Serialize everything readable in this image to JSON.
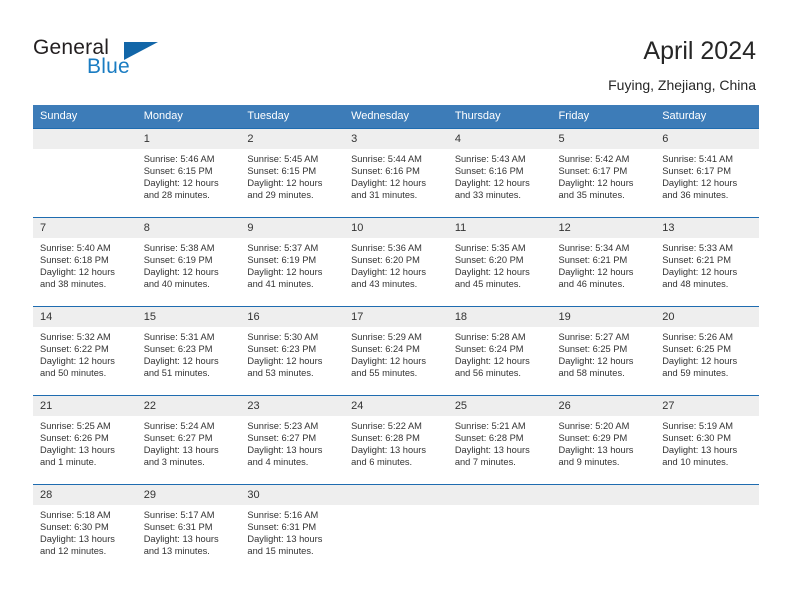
{
  "brand": {
    "name_part1": "General",
    "name_part2": "Blue",
    "accent_color": "#1266a8",
    "logo_icon": "triangle-flag-icon"
  },
  "header": {
    "title": "April 2024",
    "location": "Fuying, Zhejiang, China"
  },
  "calendar": {
    "theme": {
      "header_bg": "#3d7cb8",
      "header_text": "#ffffff",
      "row_divider": "#1f6cb0",
      "daynum_bg": "#eeeeee"
    },
    "weekday_headers": [
      "Sunday",
      "Monday",
      "Tuesday",
      "Wednesday",
      "Thursday",
      "Friday",
      "Saturday"
    ],
    "weeks": [
      [
        {
          "day": "",
          "sunrise": "",
          "sunset": "",
          "daylight_1": "",
          "daylight_2": ""
        },
        {
          "day": "1",
          "sunrise": "Sunrise: 5:46 AM",
          "sunset": "Sunset: 6:15 PM",
          "daylight_1": "Daylight: 12 hours",
          "daylight_2": "and 28 minutes."
        },
        {
          "day": "2",
          "sunrise": "Sunrise: 5:45 AM",
          "sunset": "Sunset: 6:15 PM",
          "daylight_1": "Daylight: 12 hours",
          "daylight_2": "and 29 minutes."
        },
        {
          "day": "3",
          "sunrise": "Sunrise: 5:44 AM",
          "sunset": "Sunset: 6:16 PM",
          "daylight_1": "Daylight: 12 hours",
          "daylight_2": "and 31 minutes."
        },
        {
          "day": "4",
          "sunrise": "Sunrise: 5:43 AM",
          "sunset": "Sunset: 6:16 PM",
          "daylight_1": "Daylight: 12 hours",
          "daylight_2": "and 33 minutes."
        },
        {
          "day": "5",
          "sunrise": "Sunrise: 5:42 AM",
          "sunset": "Sunset: 6:17 PM",
          "daylight_1": "Daylight: 12 hours",
          "daylight_2": "and 35 minutes."
        },
        {
          "day": "6",
          "sunrise": "Sunrise: 5:41 AM",
          "sunset": "Sunset: 6:17 PM",
          "daylight_1": "Daylight: 12 hours",
          "daylight_2": "and 36 minutes."
        }
      ],
      [
        {
          "day": "7",
          "sunrise": "Sunrise: 5:40 AM",
          "sunset": "Sunset: 6:18 PM",
          "daylight_1": "Daylight: 12 hours",
          "daylight_2": "and 38 minutes."
        },
        {
          "day": "8",
          "sunrise": "Sunrise: 5:38 AM",
          "sunset": "Sunset: 6:19 PM",
          "daylight_1": "Daylight: 12 hours",
          "daylight_2": "and 40 minutes."
        },
        {
          "day": "9",
          "sunrise": "Sunrise: 5:37 AM",
          "sunset": "Sunset: 6:19 PM",
          "daylight_1": "Daylight: 12 hours",
          "daylight_2": "and 41 minutes."
        },
        {
          "day": "10",
          "sunrise": "Sunrise: 5:36 AM",
          "sunset": "Sunset: 6:20 PM",
          "daylight_1": "Daylight: 12 hours",
          "daylight_2": "and 43 minutes."
        },
        {
          "day": "11",
          "sunrise": "Sunrise: 5:35 AM",
          "sunset": "Sunset: 6:20 PM",
          "daylight_1": "Daylight: 12 hours",
          "daylight_2": "and 45 minutes."
        },
        {
          "day": "12",
          "sunrise": "Sunrise: 5:34 AM",
          "sunset": "Sunset: 6:21 PM",
          "daylight_1": "Daylight: 12 hours",
          "daylight_2": "and 46 minutes."
        },
        {
          "day": "13",
          "sunrise": "Sunrise: 5:33 AM",
          "sunset": "Sunset: 6:21 PM",
          "daylight_1": "Daylight: 12 hours",
          "daylight_2": "and 48 minutes."
        }
      ],
      [
        {
          "day": "14",
          "sunrise": "Sunrise: 5:32 AM",
          "sunset": "Sunset: 6:22 PM",
          "daylight_1": "Daylight: 12 hours",
          "daylight_2": "and 50 minutes."
        },
        {
          "day": "15",
          "sunrise": "Sunrise: 5:31 AM",
          "sunset": "Sunset: 6:23 PM",
          "daylight_1": "Daylight: 12 hours",
          "daylight_2": "and 51 minutes."
        },
        {
          "day": "16",
          "sunrise": "Sunrise: 5:30 AM",
          "sunset": "Sunset: 6:23 PM",
          "daylight_1": "Daylight: 12 hours",
          "daylight_2": "and 53 minutes."
        },
        {
          "day": "17",
          "sunrise": "Sunrise: 5:29 AM",
          "sunset": "Sunset: 6:24 PM",
          "daylight_1": "Daylight: 12 hours",
          "daylight_2": "and 55 minutes."
        },
        {
          "day": "18",
          "sunrise": "Sunrise: 5:28 AM",
          "sunset": "Sunset: 6:24 PM",
          "daylight_1": "Daylight: 12 hours",
          "daylight_2": "and 56 minutes."
        },
        {
          "day": "19",
          "sunrise": "Sunrise: 5:27 AM",
          "sunset": "Sunset: 6:25 PM",
          "daylight_1": "Daylight: 12 hours",
          "daylight_2": "and 58 minutes."
        },
        {
          "day": "20",
          "sunrise": "Sunrise: 5:26 AM",
          "sunset": "Sunset: 6:25 PM",
          "daylight_1": "Daylight: 12 hours",
          "daylight_2": "and 59 minutes."
        }
      ],
      [
        {
          "day": "21",
          "sunrise": "Sunrise: 5:25 AM",
          "sunset": "Sunset: 6:26 PM",
          "daylight_1": "Daylight: 13 hours",
          "daylight_2": "and 1 minute."
        },
        {
          "day": "22",
          "sunrise": "Sunrise: 5:24 AM",
          "sunset": "Sunset: 6:27 PM",
          "daylight_1": "Daylight: 13 hours",
          "daylight_2": "and 3 minutes."
        },
        {
          "day": "23",
          "sunrise": "Sunrise: 5:23 AM",
          "sunset": "Sunset: 6:27 PM",
          "daylight_1": "Daylight: 13 hours",
          "daylight_2": "and 4 minutes."
        },
        {
          "day": "24",
          "sunrise": "Sunrise: 5:22 AM",
          "sunset": "Sunset: 6:28 PM",
          "daylight_1": "Daylight: 13 hours",
          "daylight_2": "and 6 minutes."
        },
        {
          "day": "25",
          "sunrise": "Sunrise: 5:21 AM",
          "sunset": "Sunset: 6:28 PM",
          "daylight_1": "Daylight: 13 hours",
          "daylight_2": "and 7 minutes."
        },
        {
          "day": "26",
          "sunrise": "Sunrise: 5:20 AM",
          "sunset": "Sunset: 6:29 PM",
          "daylight_1": "Daylight: 13 hours",
          "daylight_2": "and 9 minutes."
        },
        {
          "day": "27",
          "sunrise": "Sunrise: 5:19 AM",
          "sunset": "Sunset: 6:30 PM",
          "daylight_1": "Daylight: 13 hours",
          "daylight_2": "and 10 minutes."
        }
      ],
      [
        {
          "day": "28",
          "sunrise": "Sunrise: 5:18 AM",
          "sunset": "Sunset: 6:30 PM",
          "daylight_1": "Daylight: 13 hours",
          "daylight_2": "and 12 minutes."
        },
        {
          "day": "29",
          "sunrise": "Sunrise: 5:17 AM",
          "sunset": "Sunset: 6:31 PM",
          "daylight_1": "Daylight: 13 hours",
          "daylight_2": "and 13 minutes."
        },
        {
          "day": "30",
          "sunrise": "Sunrise: 5:16 AM",
          "sunset": "Sunset: 6:31 PM",
          "daylight_1": "Daylight: 13 hours",
          "daylight_2": "and 15 minutes."
        },
        {
          "day": "",
          "sunrise": "",
          "sunset": "",
          "daylight_1": "",
          "daylight_2": ""
        },
        {
          "day": "",
          "sunrise": "",
          "sunset": "",
          "daylight_1": "",
          "daylight_2": ""
        },
        {
          "day": "",
          "sunrise": "",
          "sunset": "",
          "daylight_1": "",
          "daylight_2": ""
        },
        {
          "day": "",
          "sunrise": "",
          "sunset": "",
          "daylight_1": "",
          "daylight_2": ""
        }
      ]
    ]
  }
}
